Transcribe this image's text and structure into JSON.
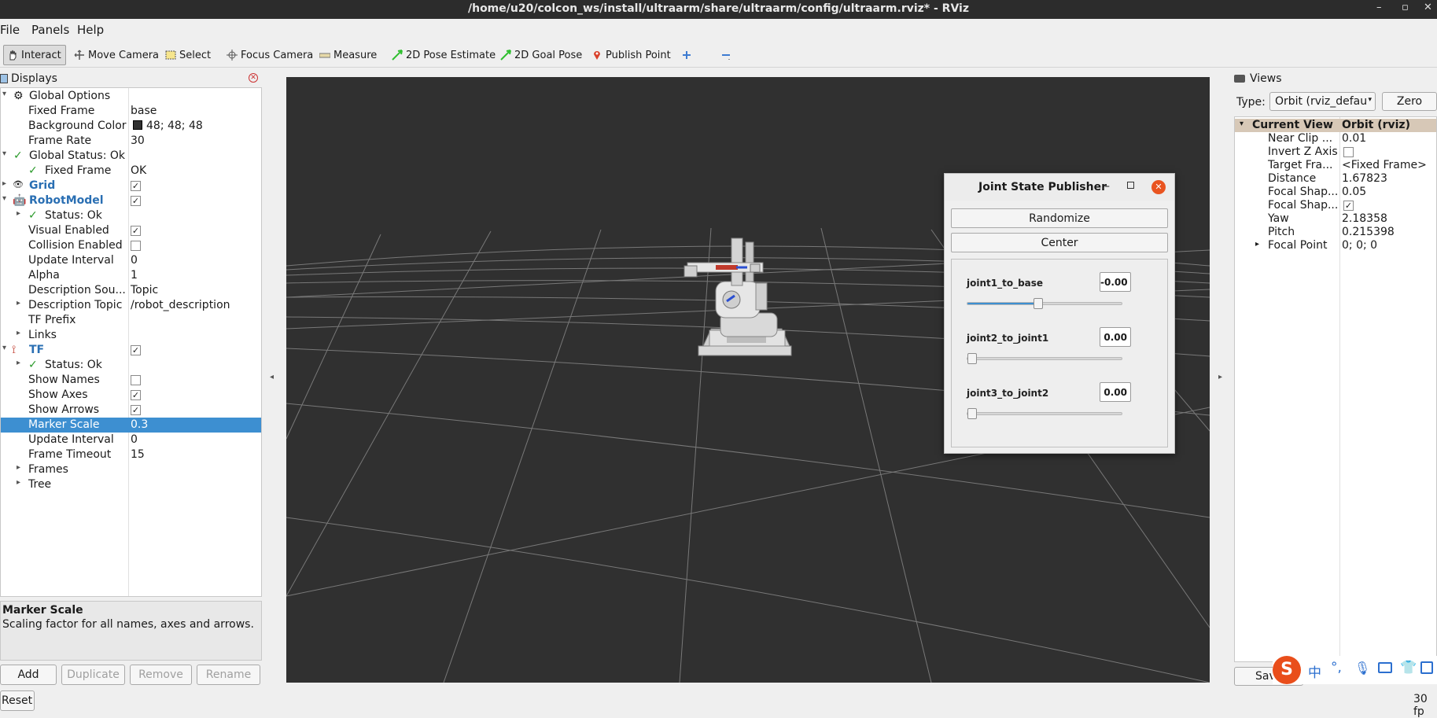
{
  "window": {
    "title": "/home/u20/colcon_ws/install/ultraarm/share/ultraarm/config/ultraarm.rviz* - RViz"
  },
  "menu": [
    "File",
    "Panels",
    "Help"
  ],
  "toolbar": {
    "interact": "Interact",
    "move_camera": "Move Camera",
    "select": "Select",
    "focus_camera": "Focus Camera",
    "measure": "Measure",
    "pose_estimate": "2D Pose Estimate",
    "goal_pose": "2D Goal Pose",
    "publish_point": "Publish Point"
  },
  "displays": {
    "title": "Displays",
    "rows": [
      {
        "label": "Global Options",
        "value": ""
      },
      {
        "label": "Fixed Frame",
        "value": "base"
      },
      {
        "label": "Background Color",
        "value": "48; 48; 48"
      },
      {
        "label": "Frame Rate",
        "value": "30"
      },
      {
        "label": "Global Status: Ok",
        "value": ""
      },
      {
        "label": "Fixed Frame",
        "value": "OK"
      },
      {
        "label": "Grid",
        "value": ""
      },
      {
        "label": "RobotModel",
        "value": ""
      },
      {
        "label": "Status: Ok",
        "value": ""
      },
      {
        "label": "Visual Enabled",
        "value": ""
      },
      {
        "label": "Collision Enabled",
        "value": ""
      },
      {
        "label": "Update Interval",
        "value": "0"
      },
      {
        "label": "Alpha",
        "value": "1"
      },
      {
        "label": "Description Sou...",
        "value": "Topic"
      },
      {
        "label": "Description Topic",
        "value": "/robot_description"
      },
      {
        "label": "TF Prefix",
        "value": ""
      },
      {
        "label": "Links",
        "value": ""
      },
      {
        "label": "TF",
        "value": ""
      },
      {
        "label": "Status: Ok",
        "value": ""
      },
      {
        "label": "Show Names",
        "value": ""
      },
      {
        "label": "Show Axes",
        "value": ""
      },
      {
        "label": "Show Arrows",
        "value": ""
      },
      {
        "label": "Marker Scale",
        "value": "0.3"
      },
      {
        "label": "Update Interval",
        "value": "0"
      },
      {
        "label": "Frame Timeout",
        "value": "15"
      },
      {
        "label": "Frames",
        "value": ""
      },
      {
        "label": "Tree",
        "value": ""
      }
    ],
    "description_title": "Marker Scale",
    "description_text": "Scaling factor for all names, axes and arrows.",
    "buttons": {
      "add": "Add",
      "duplicate": "Duplicate",
      "remove": "Remove",
      "rename": "Rename"
    },
    "reset": "Reset",
    "background_color_hex": "#303030",
    "selection_color": "#3d8fd1"
  },
  "joint_state_publisher": {
    "title": "Joint State Publisher",
    "randomize": "Randomize",
    "center": "Center",
    "joints": [
      {
        "name": "joint1_to_base",
        "value": "-0.00",
        "slider_fraction": 0.45
      },
      {
        "name": "joint2_to_joint1",
        "value": "0.00",
        "slider_fraction": 0.0
      },
      {
        "name": "joint3_to_joint2",
        "value": "0.00",
        "slider_fraction": 0.0
      }
    ]
  },
  "views": {
    "title": "Views",
    "type_label": "Type:",
    "type_value": "Orbit (rviz_defau",
    "zero": "Zero",
    "header": {
      "label": "Current View",
      "value": "Orbit (rviz)"
    },
    "rows": [
      {
        "label": "Near Clip ...",
        "value": "0.01"
      },
      {
        "label": "Invert Z Axis",
        "value": ""
      },
      {
        "label": "Target Fra...",
        "value": "<Fixed Frame>"
      },
      {
        "label": "Distance",
        "value": "1.67823"
      },
      {
        "label": "Focal Shap...",
        "value": "0.05"
      },
      {
        "label": "Focal Shap...",
        "value": ""
      },
      {
        "label": "Yaw",
        "value": "2.18358"
      },
      {
        "label": "Pitch",
        "value": "0.215398"
      },
      {
        "label": "Focal Point",
        "value": "0; 0; 0"
      }
    ],
    "save": "Save"
  },
  "status": {
    "fps": "30 fp"
  },
  "ime": {
    "logo": "S",
    "chinese": "中"
  }
}
